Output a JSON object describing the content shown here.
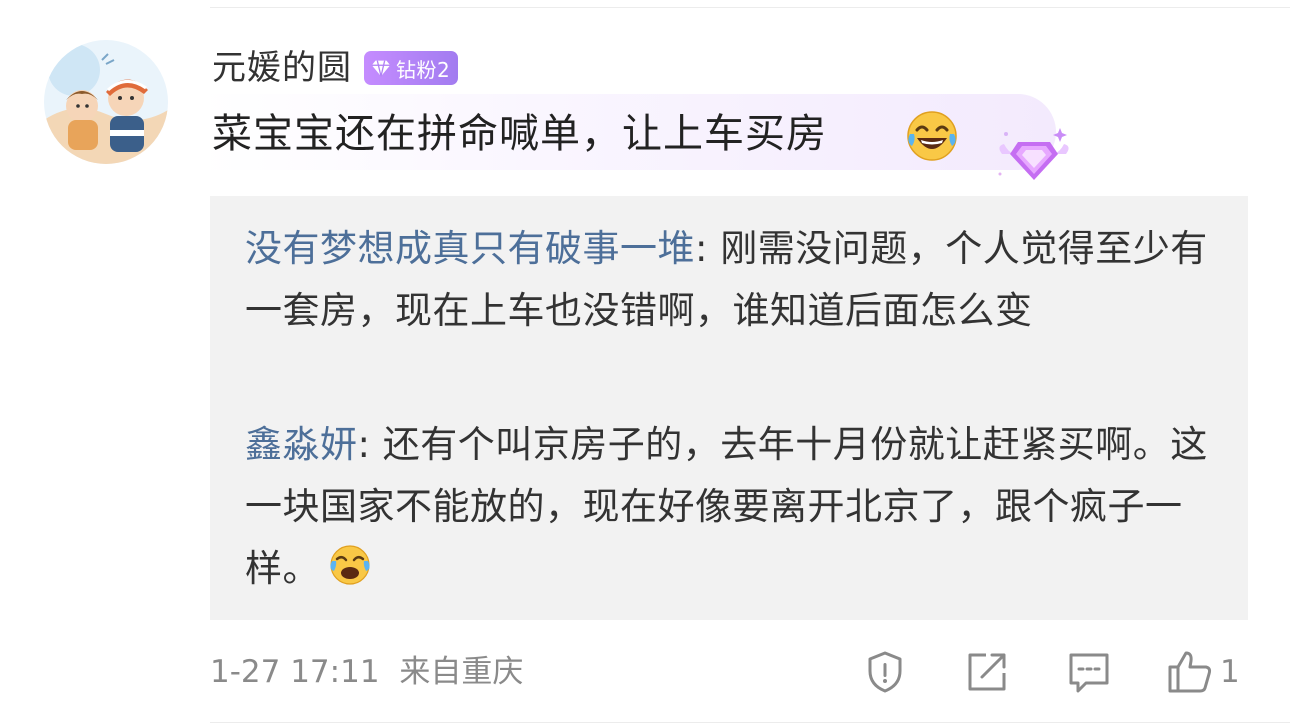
{
  "comment": {
    "username": "元媛的圆",
    "badge_label": "钻粉2",
    "text": "菜宝宝还在拼命喊单，让上车买房",
    "emoji": "laughing-tears-icon",
    "timestamp": "1-27 17:11",
    "location": "来自重庆",
    "like_count": "1"
  },
  "replies": [
    {
      "user": "没有梦想成真只有破事一堆",
      "sep": ":",
      "text": " 刚需没问题，个人觉得至少有一套房，现在上车也没错啊，谁知道后面怎么变"
    },
    {
      "user": "鑫淼妍",
      "sep": ":",
      "text": " 还有个叫京房子的，去年十月份就让赶紧买啊。这一块国家不能放的，现在好像要离开北京了，跟个疯子一样。",
      "emoji": "crying-laughing-icon"
    }
  ],
  "colors": {
    "reply_user": "#4d6f99",
    "badge": "#b07ff5",
    "reply_background": "#f2f2f2",
    "meta_text": "#8a8a8a"
  },
  "icons": {
    "report": "report-icon",
    "share": "share-icon",
    "comment": "comment-icon",
    "like": "like-icon"
  }
}
